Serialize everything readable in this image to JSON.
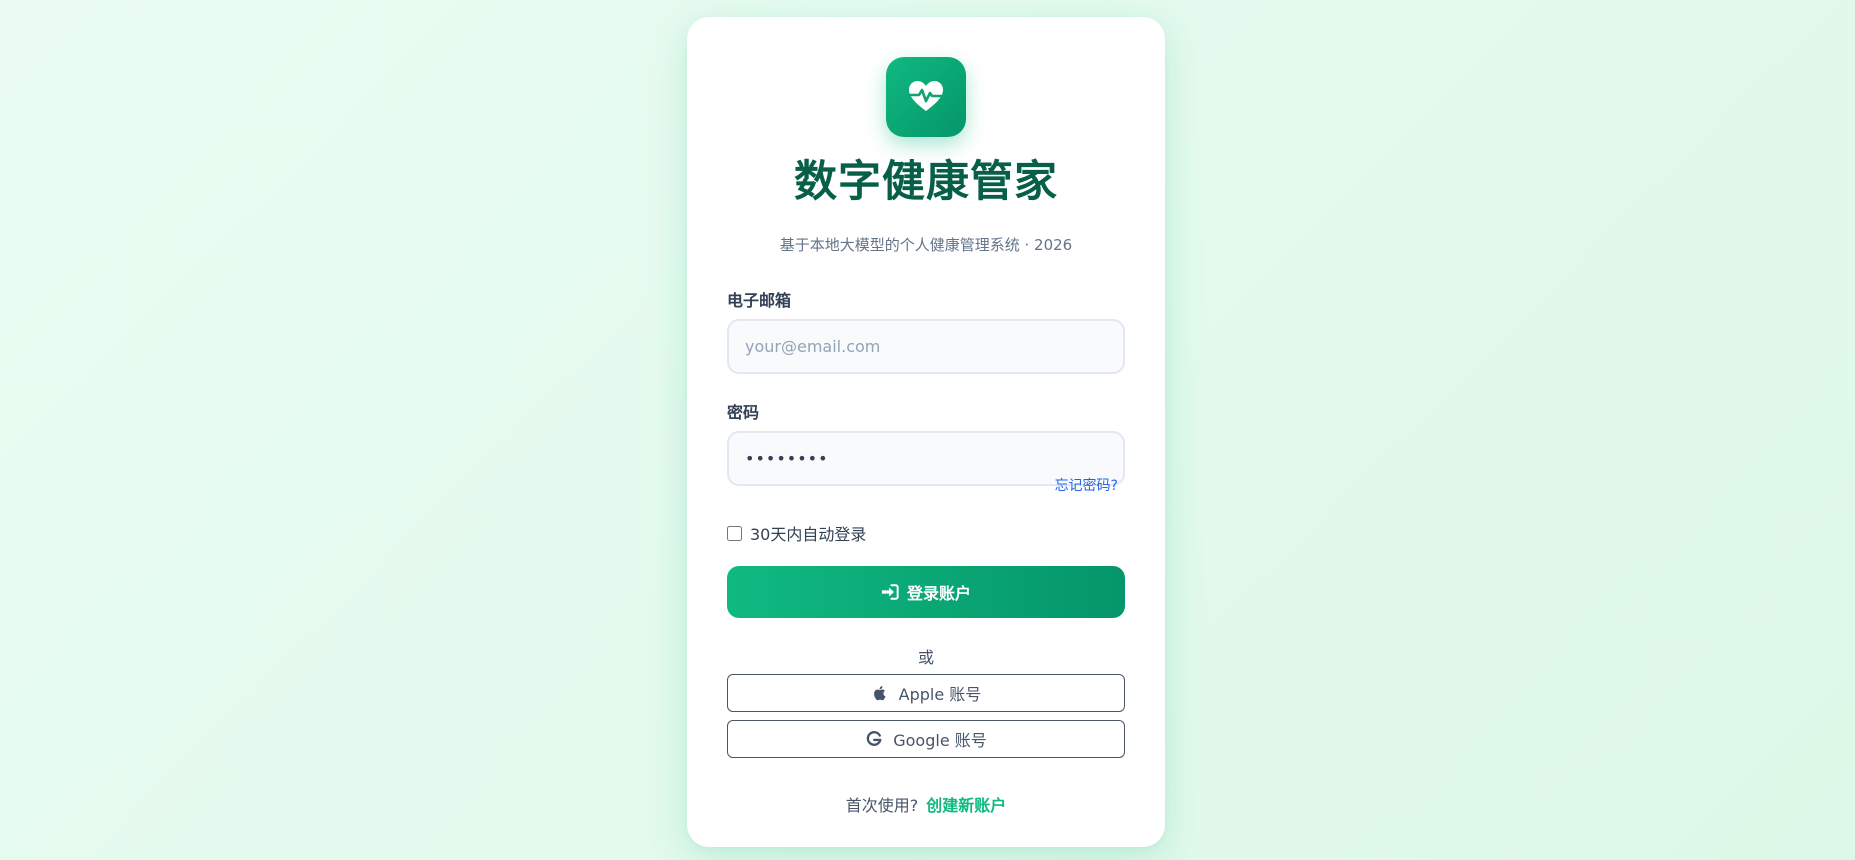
{
  "app": {
    "title": "数字健康管家",
    "subtitle": "基于本地大模型的个人健康管理系统 · 2026",
    "logo_icon": "heart-pulse-icon",
    "accent_color": "#10b981"
  },
  "form": {
    "email_label": "电子邮箱",
    "email_placeholder": "your@email.com",
    "email_value": "",
    "password_label": "密码",
    "password_value": "password",
    "forgot_password": "忘记密码?",
    "remember_me": "30天内自动登录",
    "remember_me_checked": false,
    "login_button": "登录账户",
    "login_icon": "sign-in-icon"
  },
  "divider": {
    "text": "或"
  },
  "social": {
    "apple_label": "Apple 账号",
    "google_label": "Google 账号"
  },
  "footer": {
    "prompt": "首次使用?",
    "signup_link": "创建新账户"
  }
}
